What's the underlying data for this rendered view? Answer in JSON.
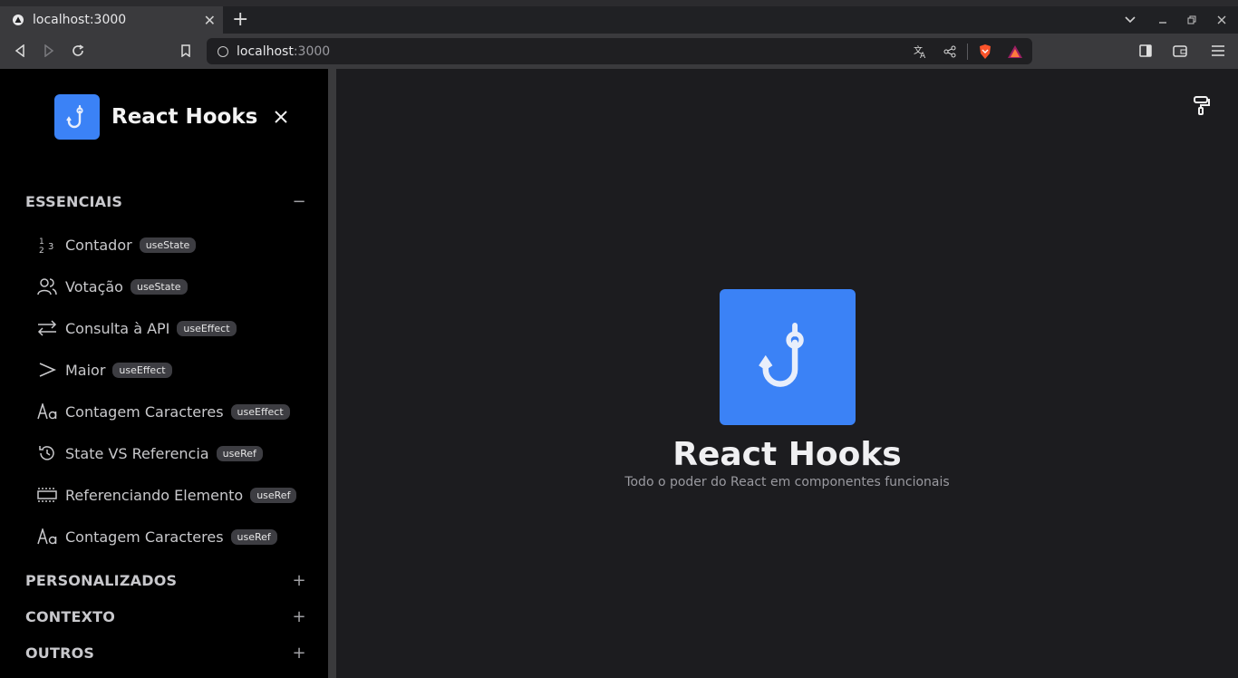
{
  "browser": {
    "tab_title": "localhost:3000",
    "tab_close": "✕",
    "new_tab": "+",
    "url_host": "localhost",
    "url_port": ":3000"
  },
  "sidebar": {
    "brand": "React Hooks",
    "sections": {
      "essenciais": {
        "label": "ESSENCIAIS",
        "toggle": "−"
      },
      "personalizados": {
        "label": "PERSONALIZADOS",
        "toggle": "+"
      },
      "contexto": {
        "label": "CONTEXTO",
        "toggle": "+"
      },
      "outros": {
        "label": "OUTROS",
        "toggle": "+"
      }
    },
    "items": [
      {
        "label": "Contador",
        "badge": "useState",
        "icon": "numbers-icon"
      },
      {
        "label": "Votação",
        "badge": "useState",
        "icon": "users-icon"
      },
      {
        "label": "Consulta à API",
        "badge": "useEffect",
        "icon": "arrows-icon"
      },
      {
        "label": "Maior",
        "badge": "useEffect",
        "icon": "greater-than-icon"
      },
      {
        "label": "Contagem Caracteres",
        "badge": "useEffect",
        "icon": "letter-case-icon"
      },
      {
        "label": "State VS Referencia",
        "badge": "useRef",
        "icon": "history-icon"
      },
      {
        "label": "Referenciando Elemento",
        "badge": "useRef",
        "icon": "frame-icon"
      },
      {
        "label": "Contagem Caracteres",
        "badge": "useRef",
        "icon": "letter-case-icon"
      }
    ]
  },
  "main": {
    "title": "React Hooks",
    "subtitle": "Todo o poder do React em componentes funcionais"
  },
  "colors": {
    "accent": "#3b82f6",
    "sidebar_bg": "#000000",
    "main_bg": "#1c1c1f"
  }
}
